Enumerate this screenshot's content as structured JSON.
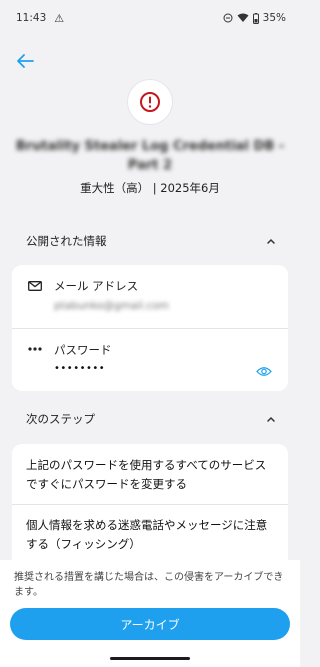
{
  "status": {
    "time": "11:43",
    "battery": "35%"
  },
  "header": {
    "title": "Brutality Stealer Log Credential DB - Part 2",
    "subtitle": "重大性（高） | 2025年6月"
  },
  "exposed": {
    "heading": "公開された情報",
    "email_label": "メール アドレス",
    "email_value": "ptabunko@gmail.com",
    "password_label": "パスワード",
    "password_value": "••••••••"
  },
  "steps": {
    "heading": "次のステップ",
    "items": [
      "上記のパスワードを使用するすべてのサービスですぐにパスワードを変更する",
      "個人情報を求める迷惑電話やメッセージに注意する（フィッシング）"
    ]
  },
  "footer": {
    "note": "推奨される措置を講じた場合は、この侵害をアーカイブできます。",
    "archive_label": "アーカイブ"
  },
  "colors": {
    "accent": "#1ea0ef",
    "alert": "#c4161c"
  }
}
